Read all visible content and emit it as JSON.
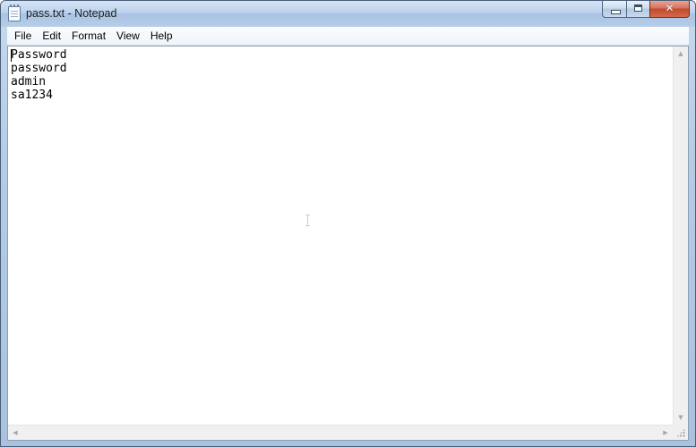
{
  "window": {
    "title": "pass.txt - Notepad",
    "close_glyph": "✕"
  },
  "menu": [
    {
      "label": "File"
    },
    {
      "label": "Edit"
    },
    {
      "label": "Format"
    },
    {
      "label": "View"
    },
    {
      "label": "Help"
    }
  ],
  "document": {
    "lines": [
      "Password",
      "password",
      "admin",
      "sa1234"
    ]
  },
  "scrollbars": {
    "up_glyph": "▲",
    "down_glyph": "▼",
    "left_glyph": "◀",
    "right_glyph": "▶"
  },
  "icons": {
    "app": "notepad-icon",
    "minimize": "minimize-icon",
    "maximize": "maximize-icon",
    "close": "close-icon",
    "size_grip": "size-grip-icon"
  },
  "colors": {
    "title_bar": "#bcd2ec",
    "close_button": "#c14a2f",
    "menu_bar": "#f0f4fa",
    "editor_background": "#ffffff",
    "scrollbar": "#f0f0f0"
  }
}
